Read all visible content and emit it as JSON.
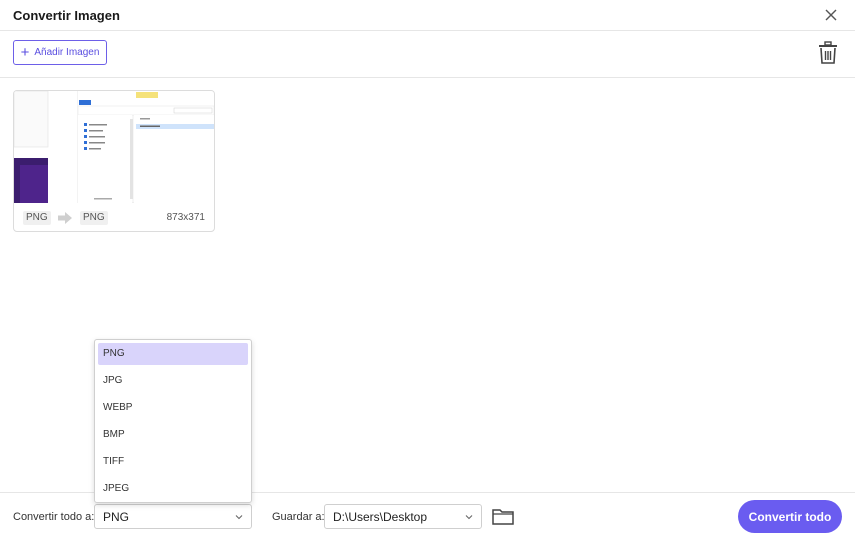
{
  "window": {
    "title": "Convertir Imagen"
  },
  "toolbar": {
    "add_label": "Añadir Imagen"
  },
  "card": {
    "from_format": "PNG",
    "to_format": "PNG",
    "dimensions": "873x371"
  },
  "bottom": {
    "convert_all_label": "Convertir todo a:",
    "convert_all_value": "PNG",
    "save_to_label": "Guardar a:",
    "save_to_value": "D:\\Users\\Desktop",
    "convert_button": "Convertir todo"
  },
  "dropdown": {
    "options": [
      "PNG",
      "JPG",
      "WEBP",
      "BMP",
      "TIFF",
      "JPEG"
    ],
    "selected": "PNG"
  },
  "colors": {
    "accent": "#6a5cf0",
    "selected_option": "#d9d4fb"
  },
  "icons": {
    "close": "close-icon",
    "add": "plus-icon",
    "trash": "trash-icon",
    "arrow": "arrow-right-icon",
    "chevron": "chevron-down-icon",
    "folder": "folder-icon"
  }
}
